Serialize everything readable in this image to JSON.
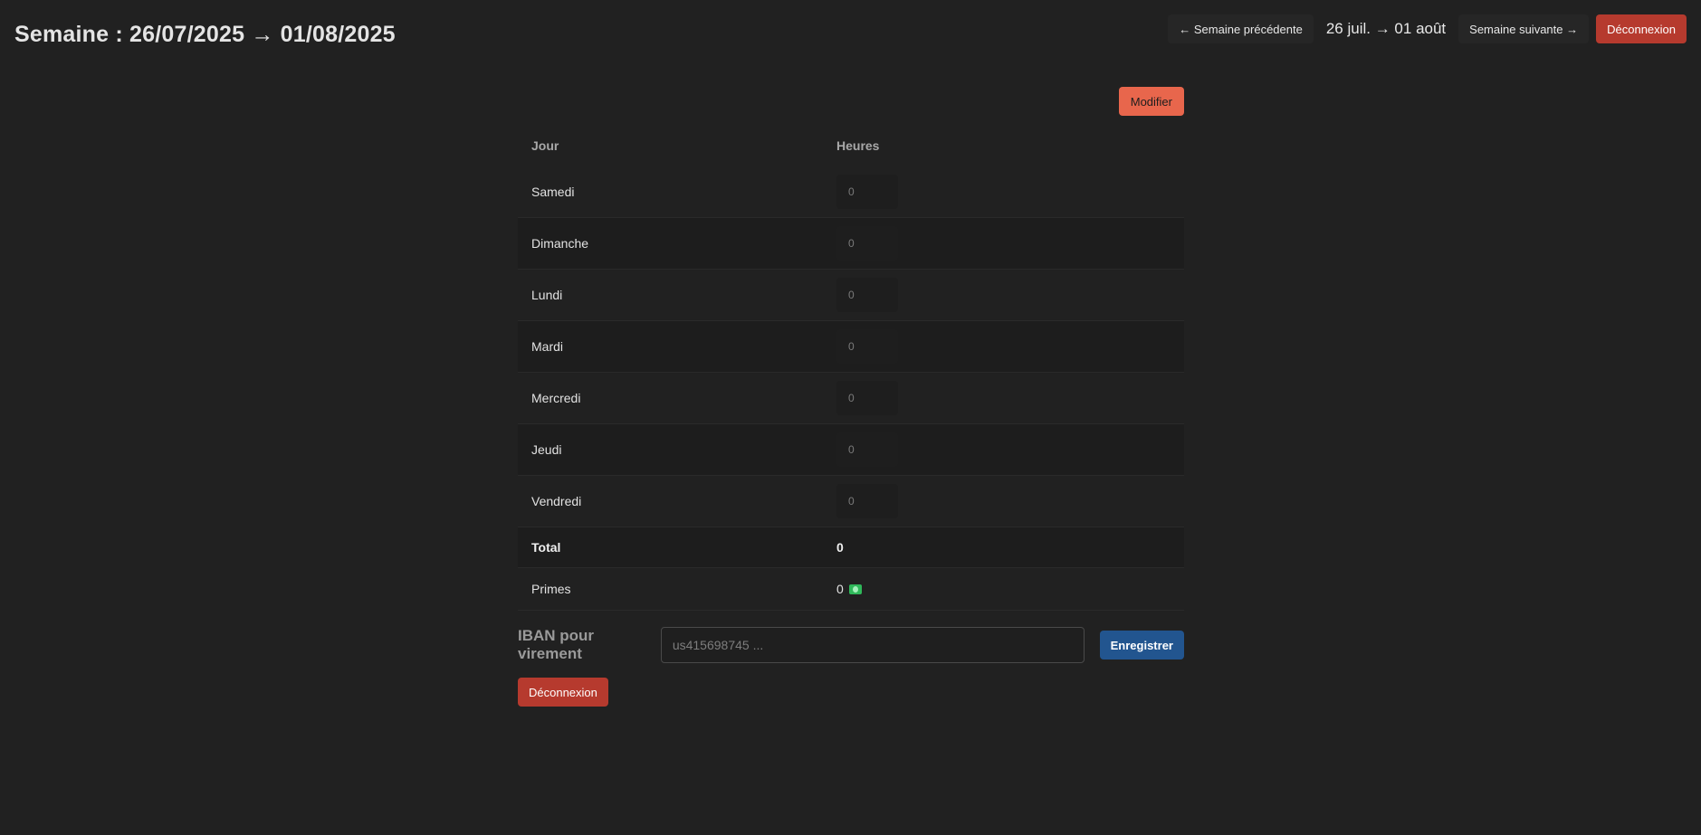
{
  "header": {
    "title": "Semaine : 26/07/2025 → 01/08/2025",
    "prev_week_label": "← Semaine précédente",
    "week_range": "26 juil. → 01 août",
    "next_week_label": "Semaine suivante →",
    "logout_label": "Déconnexion"
  },
  "toolbar": {
    "edit_label": "Modifier"
  },
  "table": {
    "columns": [
      "Jour",
      "Heures"
    ],
    "rows": [
      {
        "day": "Samedi",
        "hours_placeholder": "0"
      },
      {
        "day": "Dimanche",
        "hours_placeholder": "0"
      },
      {
        "day": "Lundi",
        "hours_placeholder": "0"
      },
      {
        "day": "Mardi",
        "hours_placeholder": "0"
      },
      {
        "day": "Mercredi",
        "hours_placeholder": "0"
      },
      {
        "day": "Jeudi",
        "hours_placeholder": "0"
      },
      {
        "day": "Vendredi",
        "hours_placeholder": "0"
      }
    ],
    "total_label": "Total",
    "total_value": "0",
    "primes_label": "Primes",
    "primes_value": "0",
    "primes_icon": "money-icon"
  },
  "iban": {
    "label": "IBAN pour virement",
    "placeholder": "us415698745 ...",
    "value": "",
    "save_label": "Enregistrer"
  },
  "footer": {
    "logout_label": "Déconnexion"
  },
  "colors": {
    "background": "#212121",
    "edit_button": "#e8664c",
    "logout_button": "#b63a2e",
    "save_button": "#22558f"
  }
}
